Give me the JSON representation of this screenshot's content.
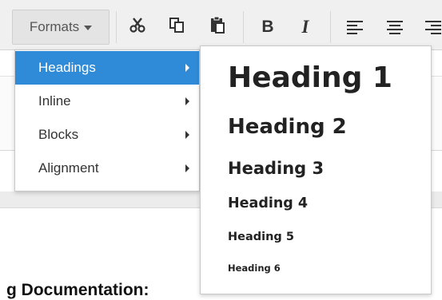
{
  "toolbar": {
    "formats_label": "Formats",
    "tools": [
      {
        "name": "cut-icon",
        "glyph": "✂"
      },
      {
        "name": "copy-icon",
        "glyph": "⧉"
      },
      {
        "name": "paste-icon",
        "glyph": "📋"
      },
      {
        "name": "bold-icon",
        "glyph": "B"
      },
      {
        "name": "italic-icon",
        "glyph": "I"
      },
      {
        "name": "align-left-icon"
      },
      {
        "name": "align-center-icon"
      },
      {
        "name": "align-right-icon"
      }
    ]
  },
  "formats_menu": {
    "items": [
      {
        "label": "Headings",
        "active": true
      },
      {
        "label": "Inline",
        "active": false
      },
      {
        "label": "Blocks",
        "active": false
      },
      {
        "label": "Alignment",
        "active": false
      }
    ]
  },
  "headings_submenu": {
    "items": [
      {
        "label": "Heading 1"
      },
      {
        "label": "Heading 2"
      },
      {
        "label": "Heading 3"
      },
      {
        "label": "Heading 4"
      },
      {
        "label": "Heading 5"
      },
      {
        "label": "Heading 6"
      }
    ]
  },
  "editor": {
    "visible_text": "g Documentation:"
  },
  "colors": {
    "active_item_bg": "#2f8bd8",
    "toolbar_bg": "#f0f0f0"
  }
}
